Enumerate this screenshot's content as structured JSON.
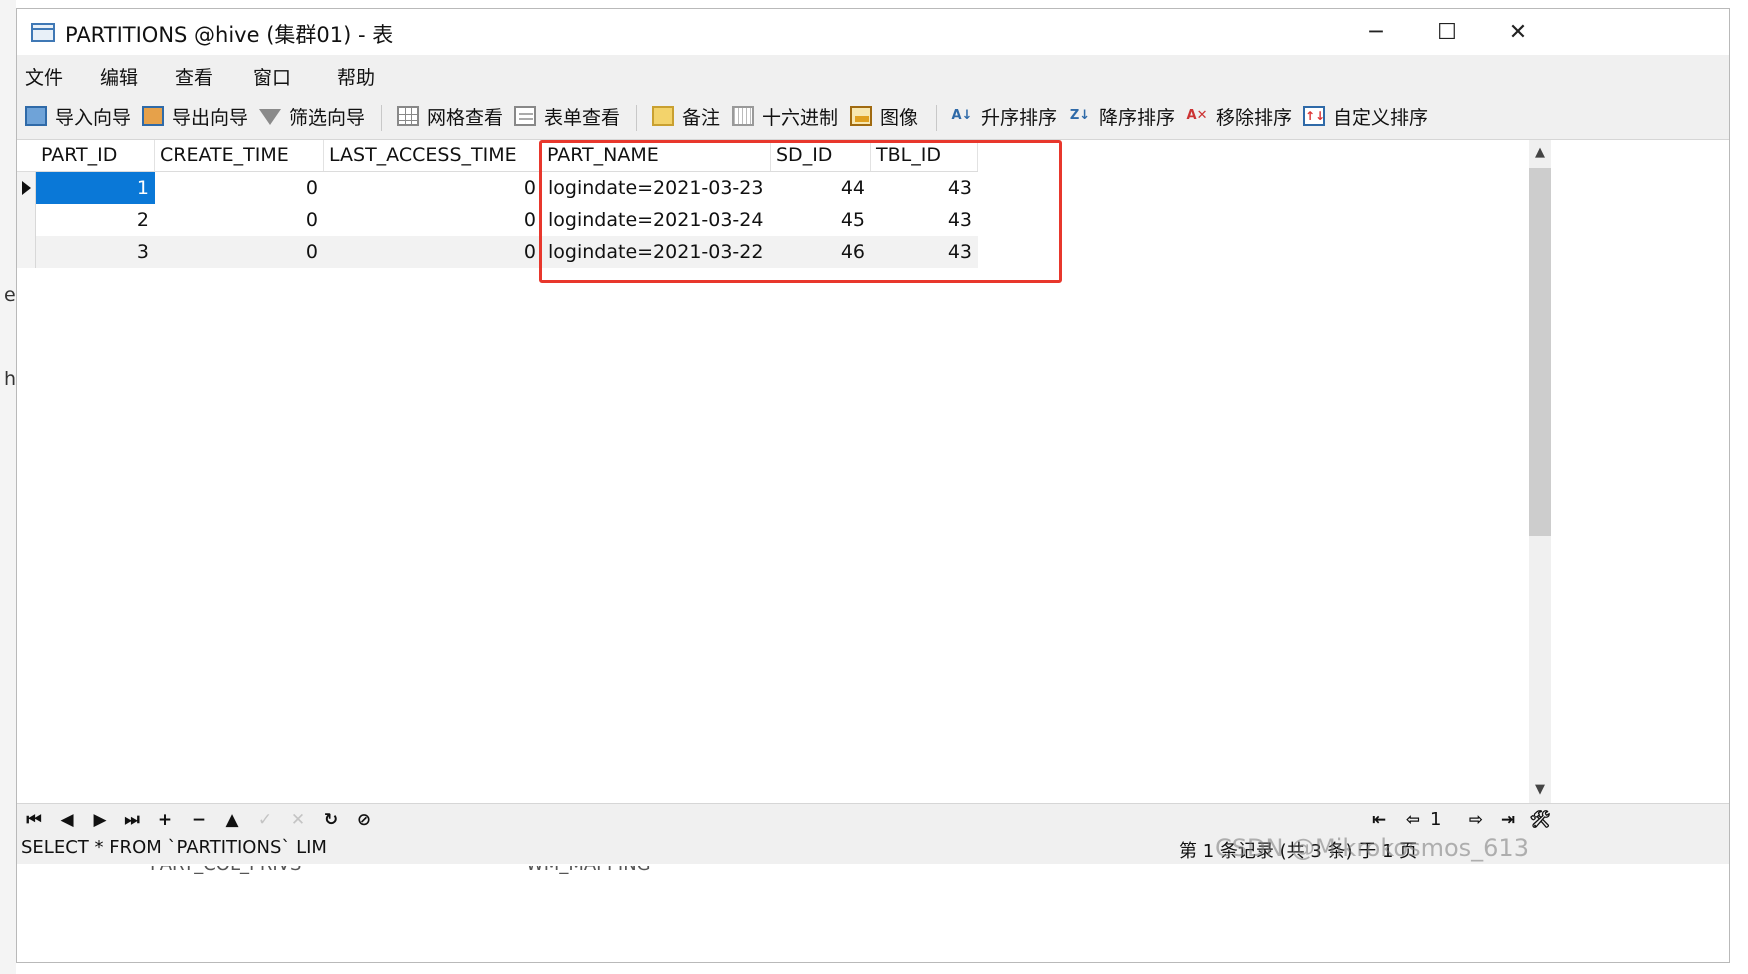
{
  "window": {
    "title": "PARTITIONS @hive (集群01) - 表",
    "controls": {
      "minimize": "─",
      "maximize": "☐",
      "close": "✕"
    }
  },
  "menu": [
    "文件",
    "编辑",
    "查看",
    "窗口",
    "帮助"
  ],
  "toolbar": {
    "import_wizard": "导入向导",
    "export_wizard": "导出向导",
    "filter_wizard": "筛选向导",
    "grid_view": "网格查看",
    "form_view": "表单查看",
    "memo": "备注",
    "hex": "十六进制",
    "image": "图像",
    "sort_asc": "升序排序",
    "sort_desc": "降序排序",
    "remove_sort": "移除排序",
    "custom_sort": "自定义排序"
  },
  "grid": {
    "columns": [
      "PART_ID",
      "CREATE_TIME",
      "LAST_ACCESS_TIME",
      "PART_NAME",
      "SD_ID",
      "TBL_ID"
    ],
    "rows": [
      [
        "1",
        "0",
        "0",
        "logindate=2021-03-23",
        "44",
        "43"
      ],
      [
        "2",
        "0",
        "0",
        "logindate=2021-03-24",
        "45",
        "43"
      ],
      [
        "3",
        "0",
        "0",
        "logindate=2021-03-22",
        "46",
        "43"
      ]
    ],
    "selected_row": 0,
    "highlight_color": "#e8372c"
  },
  "navigator": {
    "first": "⏮",
    "prev": "◀",
    "next": "▶",
    "last": "⏭",
    "add": "+",
    "delete": "−",
    "post": "▲",
    "commit": "✓",
    "cancel": "✕",
    "refresh": "↻",
    "stop": "⊘",
    "page_first": "⇤",
    "page_prev": "⇦",
    "page_number": "1",
    "page_next": "⇨",
    "page_last": "⇥",
    "tools": "🛠"
  },
  "status": {
    "sql": "SELECT * FROM `PARTITIONS` LIM",
    "page_info": "第 1 条记录 (共 3 条) 于 1 页"
  },
  "background": {
    "left_fragments": [
      "e",
      "h"
    ],
    "tabs_below": [
      "PART_COL_PRIVS",
      "WM_MAPPING"
    ]
  },
  "watermark": "CSDN @Mikrokosmos_613"
}
